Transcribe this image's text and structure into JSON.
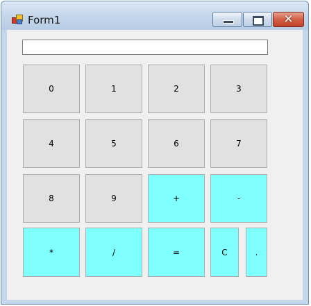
{
  "window": {
    "title": "Form1",
    "controls": {
      "minimize": "minimize-icon",
      "maximize": "maximize-icon",
      "close": "close-icon"
    },
    "colors": {
      "titlebar": "#c3d5ea",
      "client": "#f0f0f0",
      "close": "#c2432a"
    }
  },
  "display": {
    "value": "",
    "placeholder": ""
  },
  "keypad": {
    "k0": "0",
    "k1": "1",
    "k2": "2",
    "k3": "3",
    "k4": "4",
    "k5": "5",
    "k6": "6",
    "k7": "7",
    "k8": "8",
    "k9": "9",
    "plus": "+",
    "minus": "-",
    "multiply": "*",
    "divide": "/",
    "equals": "=",
    "clear": "C",
    "dot": "."
  },
  "colors": {
    "digit_key": "#e1e1e1",
    "operator_key": "#80ffff"
  }
}
